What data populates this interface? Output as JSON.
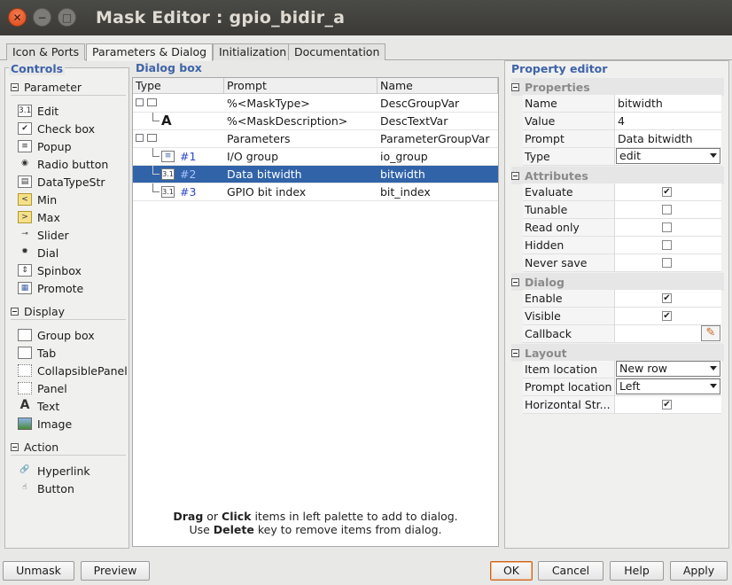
{
  "window": {
    "title": "Mask Editor : gpio_bidir_a"
  },
  "tabs": [
    {
      "label": "Icon & Ports"
    },
    {
      "label": "Parameters & Dialog"
    },
    {
      "label": "Initialization"
    },
    {
      "label": "Documentation"
    }
  ],
  "controls": {
    "title": "Controls",
    "sections": [
      {
        "label": "Parameter",
        "items": [
          "Edit",
          "Check box",
          "Popup",
          "Radio button",
          "DataTypeStr",
          "Min",
          "Max",
          "Slider",
          "Dial",
          "Spinbox",
          "Promote"
        ]
      },
      {
        "label": "Display",
        "items": [
          "Group box",
          "Tab",
          "CollapsiblePanel",
          "Panel",
          "Text",
          "Image"
        ]
      },
      {
        "label": "Action",
        "items": [
          "Hyperlink",
          "Button"
        ]
      }
    ]
  },
  "dialog": {
    "title": "Dialog box",
    "columns": [
      "Type",
      "Prompt",
      "Name"
    ],
    "rows": [
      {
        "num": "",
        "prompt": "%<MaskType>",
        "name": "DescGroupVar"
      },
      {
        "num": "",
        "prompt": "%<MaskDescription>",
        "name": "DescTextVar"
      },
      {
        "num": "",
        "prompt": "Parameters",
        "name": "ParameterGroupVar"
      },
      {
        "num": "#1",
        "prompt": "I/O group",
        "name": "io_group"
      },
      {
        "num": "#2",
        "prompt": "Data bitwidth",
        "name": "bitwidth"
      },
      {
        "num": "#3",
        "prompt": "GPIO bit index",
        "name": "bit_index"
      }
    ],
    "text_glyph": "A",
    "hint": {
      "drag": "Drag",
      "or": " or ",
      "click": "Click",
      "line1_rest": " items in left palette to add to dialog.",
      "use": "Use ",
      "delete": "Delete",
      "line2_rest": " key to remove items from dialog."
    }
  },
  "property_editor": {
    "title": "Property editor",
    "groups": {
      "properties": "Properties",
      "attributes": "Attributes",
      "dialog": "Dialog",
      "layout": "Layout"
    },
    "properties": {
      "name_label": "Name",
      "name_value": "bitwidth",
      "value_label": "Value",
      "value_value": "4",
      "prompt_label": "Prompt",
      "prompt_value": "Data bitwidth",
      "type_label": "Type",
      "type_value": "edit"
    },
    "attributes": [
      {
        "label": "Evaluate",
        "checked": true
      },
      {
        "label": "Tunable",
        "checked": false
      },
      {
        "label": "Read only",
        "checked": false
      },
      {
        "label": "Hidden",
        "checked": false
      },
      {
        "label": "Never save",
        "checked": false
      }
    ],
    "dialog_rows": [
      {
        "label": "Enable",
        "checked": true
      },
      {
        "label": "Visible",
        "checked": true
      }
    ],
    "callback_label": "Callback",
    "layout": {
      "item_location_label": "Item location",
      "item_location_value": "New row",
      "prompt_location_label": "Prompt location",
      "prompt_location_value": "Left",
      "horizontal_label": "Horizontal Str...",
      "horizontal_checked": true
    }
  },
  "buttons": {
    "unmask": "Unmask",
    "preview": "Preview",
    "ok": "OK",
    "cancel": "Cancel",
    "help": "Help",
    "apply": "Apply"
  },
  "colors": {
    "accent": "#3e63a8",
    "selection": "#3163a8",
    "close": "#dd4814"
  }
}
